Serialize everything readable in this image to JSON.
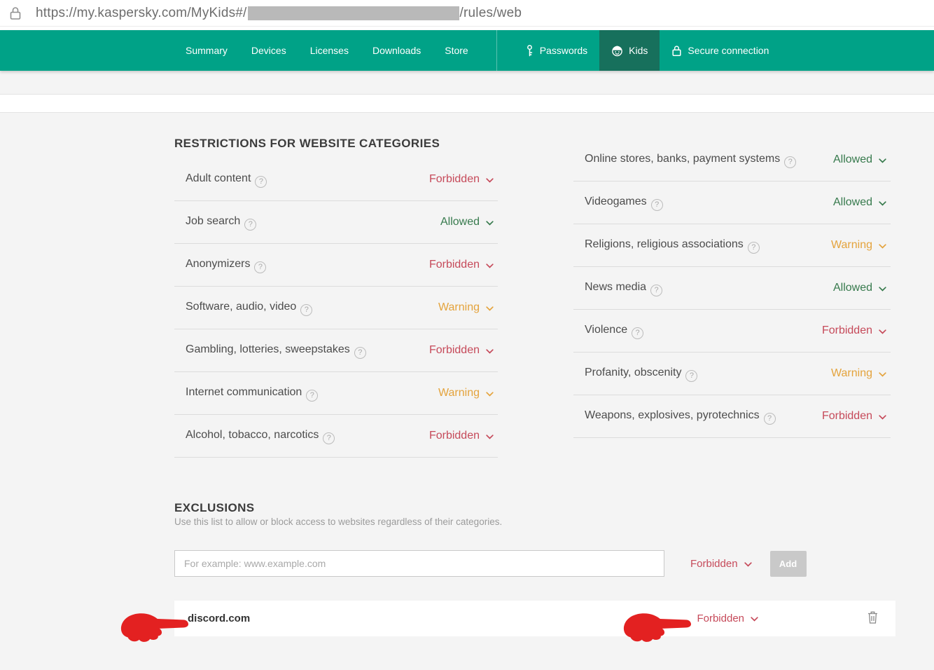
{
  "urlbar": {
    "url_prefix": "https://my.kaspersky.com/MyKids#/",
    "url_suffix": "/rules/web"
  },
  "navbar": {
    "items": [
      {
        "label": "Summary"
      },
      {
        "label": "Devices"
      },
      {
        "label": "Licenses"
      },
      {
        "label": "Downloads"
      },
      {
        "label": "Store"
      }
    ],
    "passwords_label": "Passwords",
    "kids_label": "Kids",
    "secure_label": "Secure connection",
    "active_tab": "Kids"
  },
  "colors": {
    "nav_teal": "#00a287",
    "nav_active": "#17705c",
    "forbidden": "#c64a5a",
    "allowed": "#377a4d",
    "warning": "#e4a33c",
    "annotation_red": "#e32121"
  },
  "restrictions": {
    "title": "RESTRICTIONS FOR WEBSITE CATEGORIES",
    "left_rows": [
      {
        "label": "Adult content",
        "status": "Forbidden"
      },
      {
        "label": "Job search",
        "status": "Allowed"
      },
      {
        "label": "Anonymizers",
        "status": "Forbidden"
      },
      {
        "label": "Software, audio, video",
        "status": "Warning"
      },
      {
        "label": "Gambling, lotteries, sweepstakes",
        "status": "Forbidden"
      },
      {
        "label": "Internet communication",
        "status": "Warning"
      },
      {
        "label": "Alcohol, tobacco, narcotics",
        "status": "Forbidden"
      }
    ],
    "right_rows": [
      {
        "label": "Online stores, banks, payment systems",
        "status": "Allowed"
      },
      {
        "label": "Videogames",
        "status": "Allowed"
      },
      {
        "label": "Religions, religious associations",
        "status": "Warning"
      },
      {
        "label": "News media",
        "status": "Allowed"
      },
      {
        "label": "Violence",
        "status": "Forbidden"
      },
      {
        "label": "Profanity, obscenity",
        "status": "Warning"
      },
      {
        "label": "Weapons, explosives, pyrotechnics",
        "status": "Forbidden"
      }
    ]
  },
  "exclusions": {
    "title": "EXCLUSIONS",
    "description": "Use this list to allow or block access to websites regardless of their categories.",
    "input_placeholder": "For example: www.example.com",
    "input_value": "",
    "default_status": "Forbidden",
    "add_label": "Add",
    "entries": [
      {
        "label": "discord.com",
        "status": "Forbidden"
      }
    ]
  }
}
